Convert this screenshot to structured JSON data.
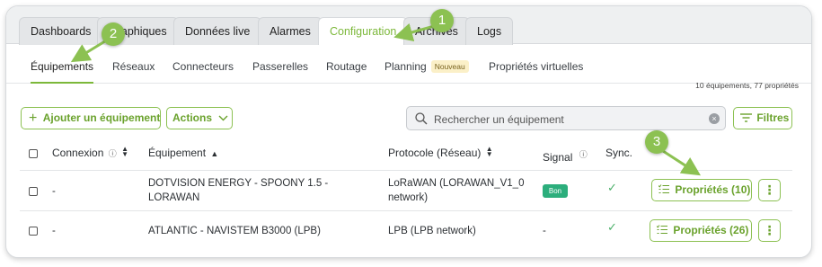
{
  "top_tabs": [
    "Dashboards",
    "Graphiques",
    "Données live",
    "Alarmes",
    "Configuration",
    "Archives",
    "Logs"
  ],
  "sub_tabs": {
    "equipements": "Équipements",
    "reseaux": "Réseaux",
    "connecteurs": "Connecteurs",
    "passerelles": "Passerelles",
    "routage": "Routage",
    "planning": "Planning",
    "planning_badge": "Nouveau",
    "proprietes_virtuelles": "Propriétés virtuelles"
  },
  "summary": "10 équipements, 77 propriétés",
  "toolbar": {
    "add_label": "Ajouter un équipement",
    "actions_label": "Actions",
    "search_placeholder": "Rechercher un équipement",
    "filters_label": "Filtres"
  },
  "table": {
    "headers": {
      "connexion": "Connexion",
      "equipement": "Équipement",
      "protocole": "Protocole (Réseau)",
      "signal": "Signal",
      "sync": "Sync."
    },
    "rows": [
      {
        "connexion": "-",
        "equipement_line1": "DOTVISION ENERGY - SPOONY 1.5 -",
        "equipement_line2": "LORAWAN",
        "protocole_line1": "LoRaWAN (LORAWAN_V1_0",
        "protocole_line2": "network)",
        "signal": "Bon",
        "proprietes": "Propriétés (10)"
      },
      {
        "connexion": "-",
        "equipement_line1": "ATLANTIC - NAVISTEM B3000 (LPB)",
        "equipement_line2": "",
        "protocole_line1": "LPB (LPB network)",
        "protocole_line2": "",
        "signal": "-",
        "proprietes": "Propriétés (26)"
      }
    ]
  },
  "markers": [
    "1",
    "2",
    "3"
  ],
  "colors": {
    "accent": "#8cc152",
    "signal_good": "#2cae7c",
    "sync_ok": "#4cb06a"
  },
  "icons": {
    "add": "plus-icon",
    "actions": "chevron-down-icon",
    "search": "search-icon",
    "clear": "clear-icon",
    "filters": "filter-icon",
    "info": "info-icon",
    "sort": "sort-icon",
    "sync": "check-icon",
    "properties": "list-icon",
    "more": "kebab-icon"
  }
}
